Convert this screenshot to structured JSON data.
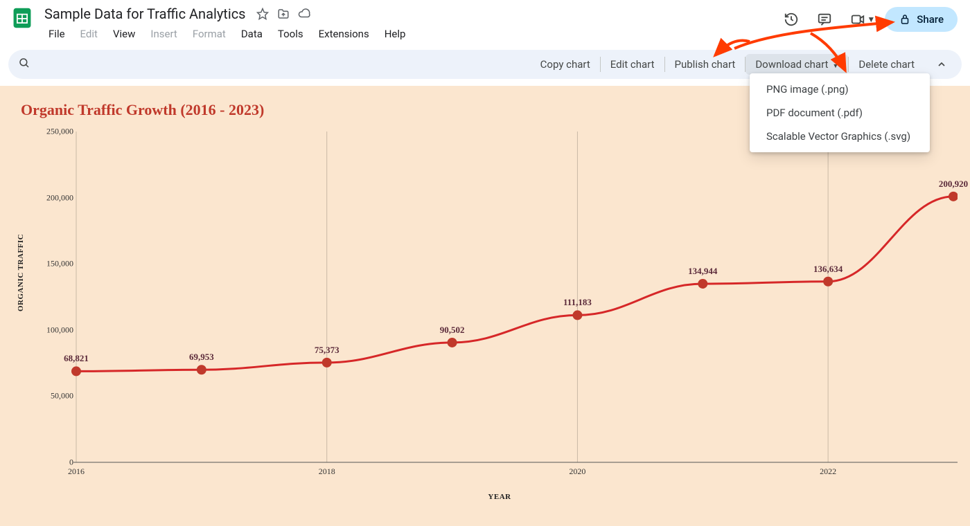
{
  "header": {
    "doc_title": "Sample Data for Traffic Analytics",
    "menus": [
      {
        "key": "file",
        "label": "File",
        "disabled": false
      },
      {
        "key": "edit",
        "label": "Edit",
        "disabled": true
      },
      {
        "key": "view",
        "label": "View",
        "disabled": false
      },
      {
        "key": "insert",
        "label": "Insert",
        "disabled": true
      },
      {
        "key": "format",
        "label": "Format",
        "disabled": true
      },
      {
        "key": "data",
        "label": "Data",
        "disabled": false
      },
      {
        "key": "tools",
        "label": "Tools",
        "disabled": false
      },
      {
        "key": "extensions",
        "label": "Extensions",
        "disabled": false
      },
      {
        "key": "help",
        "label": "Help",
        "disabled": false
      }
    ],
    "share_label": "Share"
  },
  "chart_toolbar": {
    "actions": {
      "copy": "Copy chart",
      "edit": "Edit chart",
      "publish": "Publish chart",
      "download": "Download chart",
      "delete": "Delete chart"
    }
  },
  "download_menu": {
    "items": [
      {
        "key": "png",
        "label": "PNG image (.png)"
      },
      {
        "key": "pdf",
        "label": "PDF document (.pdf)"
      },
      {
        "key": "svg",
        "label": "Scalable Vector Graphics (.svg)"
      }
    ]
  },
  "chart_data": {
    "type": "line",
    "title": "Organic Traffic Growth (2016 - 2023)",
    "xlabel": "YEAR",
    "ylabel": "ORGANIC TRAFFIC",
    "x": [
      2016,
      2017,
      2018,
      2019,
      2020,
      2021,
      2022,
      2023
    ],
    "y": [
      68821,
      69953,
      75373,
      90502,
      111183,
      134944,
      136634,
      200920
    ],
    "data_labels": [
      "68,821",
      "69,953",
      "75,373",
      "90,502",
      "111,183",
      "134,944",
      "136,634",
      "200,920"
    ],
    "x_ticks": [
      2016,
      2018,
      2020,
      2022
    ],
    "y_ticks": [
      0,
      50000,
      100000,
      150000,
      200000,
      250000
    ],
    "y_tick_labels": [
      "0",
      "50,000",
      "100,000",
      "150,000",
      "200,000",
      "250,000"
    ],
    "xlim": [
      2016,
      2023
    ],
    "ylim": [
      0,
      250000
    ],
    "line_color": "#d62728",
    "point_color": "#c0392b"
  }
}
